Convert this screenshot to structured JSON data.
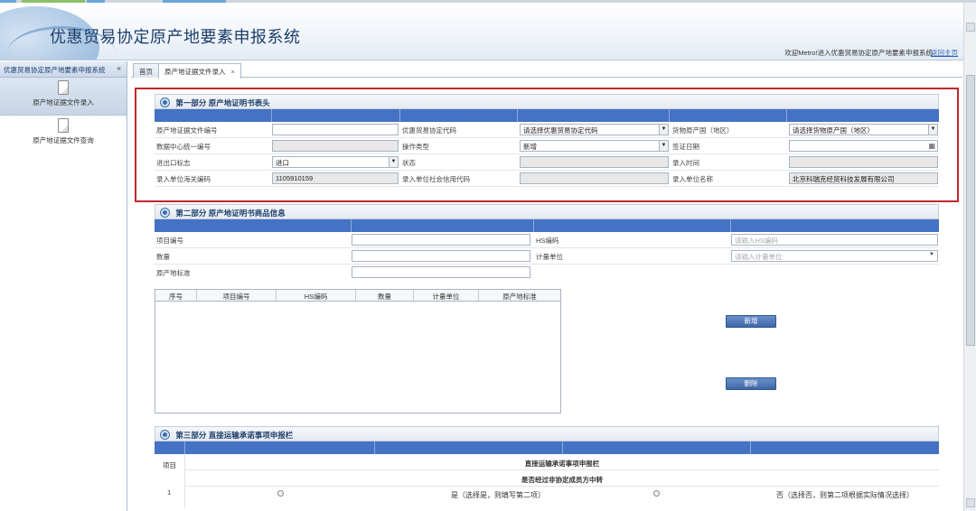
{
  "app": {
    "title": "优惠贸易协定原产地要素申报系统",
    "welcome_text": "欢迎Metro!进入优惠贸易协定原产地要素申报系统",
    "home_link": "返回主页"
  },
  "leftnav": {
    "header": "优惠贸易协定原产地要素申报系统",
    "collapse_icon": "«",
    "items": [
      {
        "label": "原产地证据文件录入",
        "active": true
      },
      {
        "label": "原产地证据文件查询",
        "active": false
      }
    ]
  },
  "tabs": [
    {
      "label": "首页"
    },
    {
      "label": "原产地证据文件录入",
      "close": "×"
    }
  ],
  "part1": {
    "title": "第一部分 原产地证明书表头",
    "labels": {
      "cert_no": "原产地证据文件编号",
      "agreement_code": "优惠贸易协定代码",
      "origin_country": "货物原产国（地区）",
      "data_center_no": "数据中心统一编号",
      "op_type": "操作类型",
      "issue_date": "签证日期",
      "ie_flag": "进出口标志",
      "status": "状态",
      "entry_time": "录入时间",
      "entry_customs_code": "录入单位海关编码",
      "entry_credit_code": "录入单位社会信用代码",
      "entry_name": "录入单位名称"
    },
    "values": {
      "agreement_code": "请选择优惠贸易协定代码",
      "origin_country": "请选择货物原产国（地区）",
      "op_type": "新增",
      "ie_flag": "进口",
      "entry_customs_code": "1105910159",
      "entry_name": "北京科瑞克经贸科技发展有限公司"
    }
  },
  "part2": {
    "title": "第二部分 原产地证明书商品信息",
    "labels": {
      "item_no": "项目编号",
      "hs_code": "HS编码",
      "quantity": "数量",
      "unit": "计量单位",
      "origin_std": "原产地标准"
    },
    "placeholders": {
      "hs_code": "请输入HS编码",
      "unit": "请输入计量单位"
    },
    "table_headers": [
      "序号",
      "项目编号",
      "HS编码",
      "数量",
      "计量单位",
      "原产地标准"
    ],
    "buttons": {
      "add": "新增",
      "delete": "删除"
    }
  },
  "part3": {
    "title": "第三部分 直接运输承诺事项申报栏",
    "col_item": "项目",
    "header": "直接运输承诺事项申报栏",
    "row1_no": "1",
    "question": "是否经过非协定成员方中转",
    "opt_yes": "是（选择是，则填写第二项）",
    "opt_no": "否（选择否，则第二项根据实际情况选择）"
  },
  "colors": {
    "accent_blue": "#4472c4",
    "highlight_red": "#c0272d",
    "title_blue": "#1d3e6b"
  }
}
